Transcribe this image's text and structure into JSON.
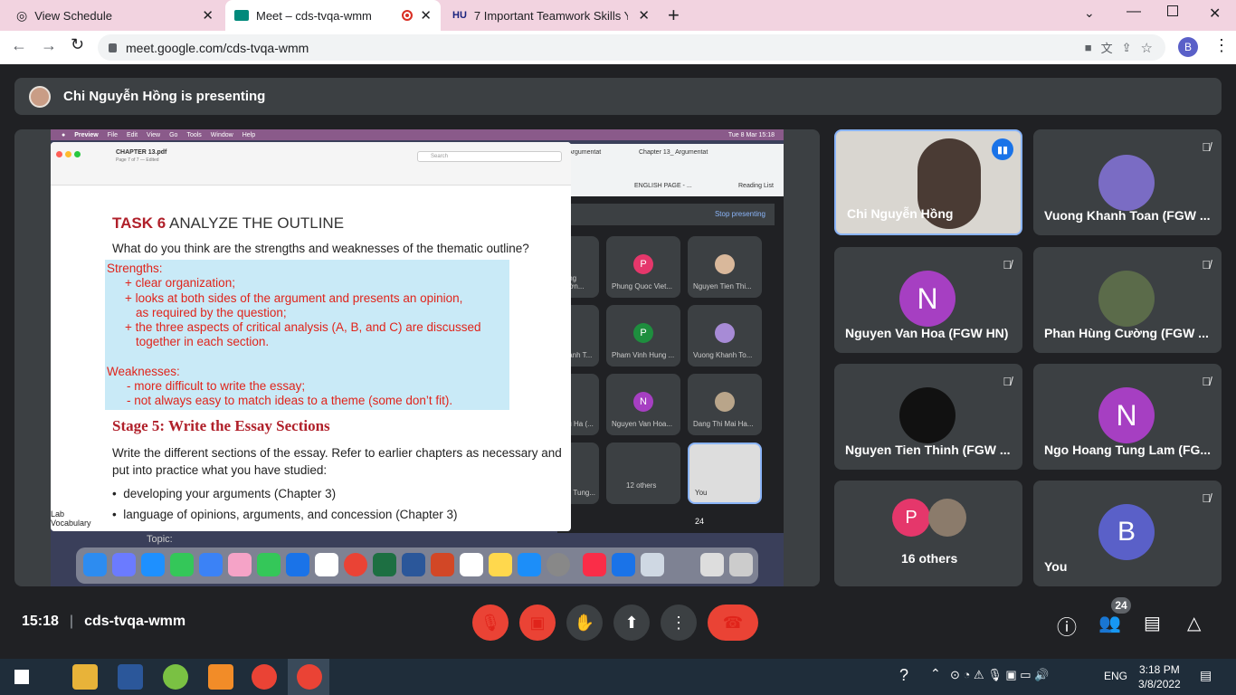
{
  "tabs": [
    {
      "title": "View Schedule"
    },
    {
      "title": "Meet – cds-tvqa-wmm"
    },
    {
      "title": "7 Important Teamwork Skills You"
    }
  ],
  "url": "meet.google.com/cds-tvqa-wmm",
  "profile_initial": "B",
  "presenting_text": "Chi Nguyễn Hồng is presenting",
  "shared": {
    "menubar": [
      "Preview",
      "File",
      "Edit",
      "View",
      "Go",
      "Tools",
      "Window",
      "Help"
    ],
    "clock": "Tue 8 Mar  15:18",
    "filename": "CHAPTER 13.pdf",
    "page_info": "Page 7 of 7 — Edited",
    "search_placeholder": "Search",
    "task_label": "TASK 6",
    "task_title": "ANALYZE THE OUTLINE",
    "question": "What do you think are the strengths and weaknesses of the thematic outline?",
    "strengths_head": "Strengths:",
    "strengths": [
      "+ clear organization;",
      "+ looks at both sides of the argument and presents an opinion,",
      "as required by the question;",
      "+ the three aspects of critical analysis (A, B, and C) are discussed",
      "together in each section."
    ],
    "weak_head": "Weaknesses:",
    "weaknesses": [
      "- more difficult to write the essay;",
      "- not always easy to match ideas to a theme (some don’t fit)."
    ],
    "stage_title": "Stage 5: Write the Essay Sections",
    "stage_text": "Write the different sections of the essay. Refer to earlier chapters as necessary and put into practice what you have studied:",
    "bullets": [
      "developing your arguments (Chapter 3)",
      "language of opinions, arguments, and concession (Chapter 3)"
    ],
    "side_labels": [
      "Lab",
      "Vocabulary"
    ],
    "topic_label": "Topic:",
    "inner_tabs": [
      "Argumentat",
      "Chapter 13_ Argumentat"
    ],
    "inner_bookmark": "ENGLISH PAGE - ...",
    "reading_list": "Reading List",
    "stop_presenting": "Stop presenting",
    "mini_tiles": [
      "Hung Cườn...",
      "Phung Quoc Viet...",
      "Nguyen Tien Thi...",
      "Doanh T...",
      "Pham Vinh Hung ...",
      "Vuong Khanh To...",
      "Thu Ha (...",
      "Nguyen Van Hoa...",
      "Dang Thi Mai Ha...",
      "ang Tung...",
      "12 others",
      "You"
    ],
    "mini_count": "24"
  },
  "participants": [
    {
      "name": "Chi Nguyễn Hồng"
    },
    {
      "name": "Vuong Khanh Toan (FGW ..."
    },
    {
      "name": "Nguyen Van Hoa (FGW HN)",
      "initial": "N",
      "color": "#a63fc2"
    },
    {
      "name": "Phan Hùng Cường (FGW ..."
    },
    {
      "name": "Nguyen Tien Thinh (FGW ..."
    },
    {
      "name": "Ngo Hoang Tung Lam (FG...",
      "initial": "N",
      "color": "#a63fc2"
    },
    {
      "name": "16 others",
      "initial": "P",
      "color": "#e5376b"
    },
    {
      "name": "You",
      "initial": "B",
      "color": "#5a60c8"
    }
  ],
  "footer": {
    "time": "15:18",
    "meeting_code": "cds-tvqa-wmm",
    "participant_count": "24"
  },
  "taskbar": {
    "time": "3:18 PM",
    "date": "3/8/2022",
    "lang": "ENG"
  }
}
